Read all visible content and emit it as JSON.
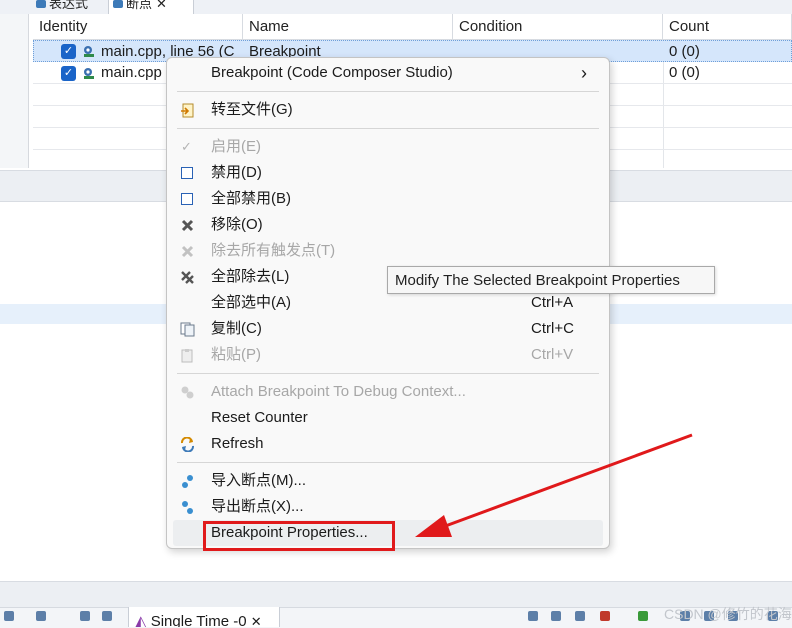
{
  "tabs": {
    "expressions": "表达式",
    "breakpoints": "断点",
    "close": "✕"
  },
  "table": {
    "headers": [
      "Identity",
      "Name",
      "Condition",
      "Count"
    ],
    "rows": [
      {
        "identity": "main.cpp, line 56 (C",
        "name": "Breakpoint",
        "condition": "",
        "count": "0 (0)"
      },
      {
        "identity": "main.cpp",
        "name": "",
        "condition": "",
        "count": "0 (0)"
      }
    ]
  },
  "menu": {
    "submenu_label": "Breakpoint (Code Composer Studio)",
    "submenu_arrow": "›",
    "goto_file": "转至文件(G)",
    "enable": "启用(E)",
    "disable": "禁用(D)",
    "disable_all": "全部禁用(B)",
    "remove": "移除(O)",
    "remove_triggers": "除去所有触发点(T)",
    "remove_all": "全部除去(L)",
    "select_all": "全部选中(A)",
    "select_all_accel": "Ctrl+A",
    "copy": "复制(C)",
    "copy_accel": "Ctrl+C",
    "paste": "粘贴(P)",
    "paste_accel": "Ctrl+V",
    "attach_context": "Attach Breakpoint To Debug Context...",
    "reset_counter": "Reset Counter",
    "refresh": "Refresh",
    "import_bp": "导入断点(M)...",
    "export_bp": "导出断点(X)...",
    "properties": "Breakpoint Properties..."
  },
  "tooltip": "Modify The Selected Breakpoint Properties",
  "bottom": {
    "tab_label": "Single Time -0",
    "tab_close": "✕",
    "watermark": "CSDN @修竹的花海"
  },
  "colors": {
    "annotation_red": "#e0191b",
    "selection_blue": "#d5e6fb",
    "checkbox_blue": "#1a64c8"
  }
}
